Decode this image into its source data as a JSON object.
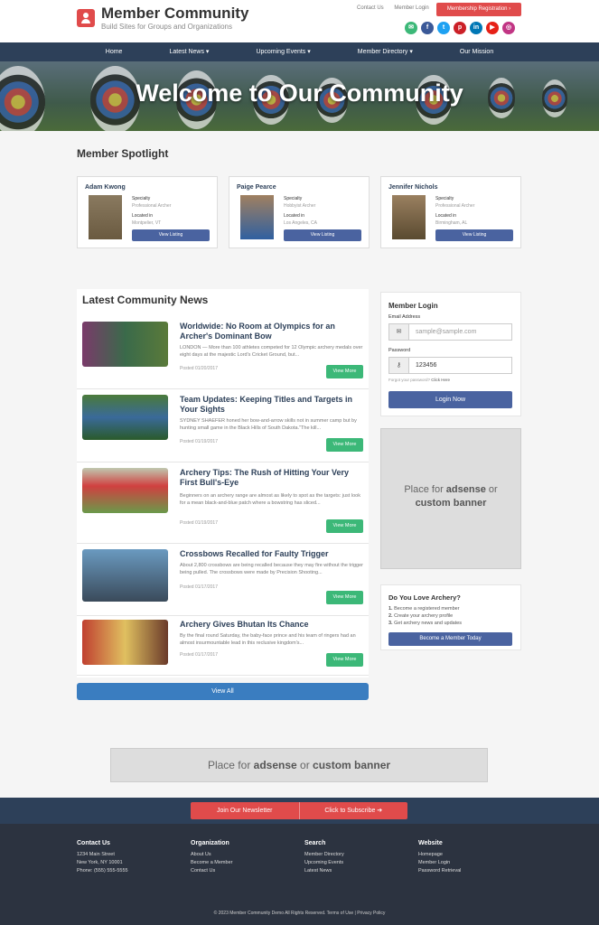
{
  "header": {
    "title": "Member Community",
    "subtitle": "Build Sites for Groups and Organizations",
    "links": [
      "Contact Us",
      "Member Login"
    ],
    "register_button": "Membership Registration",
    "socials": [
      {
        "name": "email-icon",
        "glyph": "✉",
        "color": "#3cb878"
      },
      {
        "name": "facebook-icon",
        "glyph": "f",
        "color": "#3b5998"
      },
      {
        "name": "twitter-icon",
        "glyph": "t",
        "color": "#1da1f2"
      },
      {
        "name": "pinterest-icon",
        "glyph": "p",
        "color": "#cb2027"
      },
      {
        "name": "linkedin-icon",
        "glyph": "in",
        "color": "#0077b5"
      },
      {
        "name": "youtube-icon",
        "glyph": "▶",
        "color": "#e62117"
      },
      {
        "name": "instagram-icon",
        "glyph": "◎",
        "color": "#c13584"
      }
    ]
  },
  "nav": {
    "items": [
      "Home",
      "Latest News ▾",
      "Upcoming Events ▾",
      "Member Directory ▾",
      "Our Mission"
    ]
  },
  "hero": {
    "title": "Welcome to Our Community"
  },
  "spotlight": {
    "title": "Member Spotlight",
    "specialty_label": "Specialty",
    "location_label": "Located in",
    "button": "View Listing",
    "members": [
      {
        "name": "Adam Kwong",
        "specialty": "Professional Archer",
        "location": "Montpelier, VT"
      },
      {
        "name": "Paige Pearce",
        "specialty": "Hobbyist Archer",
        "location": "Los Angeles, CA"
      },
      {
        "name": "Jennifer Nichols",
        "specialty": "Professional Archer",
        "location": "Birmingham, AL"
      }
    ]
  },
  "news": {
    "title": "Latest Community News",
    "view_more": "View More",
    "view_all": "View All",
    "items": [
      {
        "title": "Worldwide: No Room at Olympics for an Archer's Dominant Bow",
        "desc": "LONDON — More than 100 athletes competed for 12 Olympic archery medals over eight days at the majestic Lord's Cricket Ground, but...",
        "date": "Posted 01/20/2017"
      },
      {
        "title": "Team Updates: Keeping Titles and Targets in Your Sights",
        "desc": "SYDNEY SHAEFER honed her bow-and-arrow skills not in summer camp but by hunting small game in the Black Hills of South Dakota.\"The kill...",
        "date": "Posted 01/19/2017"
      },
      {
        "title": "Archery Tips: The Rush of Hitting Your Very First Bull's-Eye",
        "desc": "Beginners on an archery range are almost as likely to spot as the targets: just look for a mean black-and-blue patch where a bowstring has sliced...",
        "date": "Posted 01/19/2017"
      },
      {
        "title": "Crossbows Recalled for Faulty Trigger",
        "desc": "About 2,800 crossbows are being recalled because they may fire without the trigger being pulled. The crossbows were made by Precision Shooting...",
        "date": "Posted 01/17/2017"
      },
      {
        "title": "Archery Gives Bhutan Its Chance",
        "desc": "By the final round Saturday, the baby-face prince and his team of ringers had an almost insurmountable lead in this reclusive kingdom's...",
        "date": "Posted 01/17/2017"
      }
    ]
  },
  "login": {
    "title": "Member Login",
    "email_label": "Email Address",
    "email_placeholder": "sample@sample.com",
    "password_label": "Password",
    "password_value": "123456",
    "forgot": "Forgot your password?",
    "click_here": "Click Here",
    "button": "Login Now"
  },
  "ads": {
    "prefix": "Place for ",
    "bold1": "adsense",
    "mid": " or ",
    "bold2": "custom banner"
  },
  "promo": {
    "title": "Do You Love Archery?",
    "items": [
      "Become a registered member",
      "Create your archery profile",
      "Get archery news and updates"
    ],
    "button": "Become a Member Today"
  },
  "newsletter": {
    "left": "Join Our Newsletter",
    "right": "Click to Subscribe ➔"
  },
  "footer": {
    "columns": [
      {
        "title": "Contact Us",
        "lines": [
          "1234 Main Street",
          "New York, NY 10001",
          "Phone: (555) 555-5555"
        ]
      },
      {
        "title": "Organization",
        "lines": [
          "About Us",
          "Become a Member",
          "Contact Us"
        ]
      },
      {
        "title": "Search",
        "lines": [
          "Member Directory",
          "Upcoming Events",
          "Latest News"
        ]
      },
      {
        "title": "Website",
        "lines": [
          "Homepage",
          "Member Login",
          "Password Retrieval"
        ]
      }
    ],
    "copyright": "© 2023 Member Community Demo All Rights Reserved. Terms of Use | Privacy Policy"
  }
}
